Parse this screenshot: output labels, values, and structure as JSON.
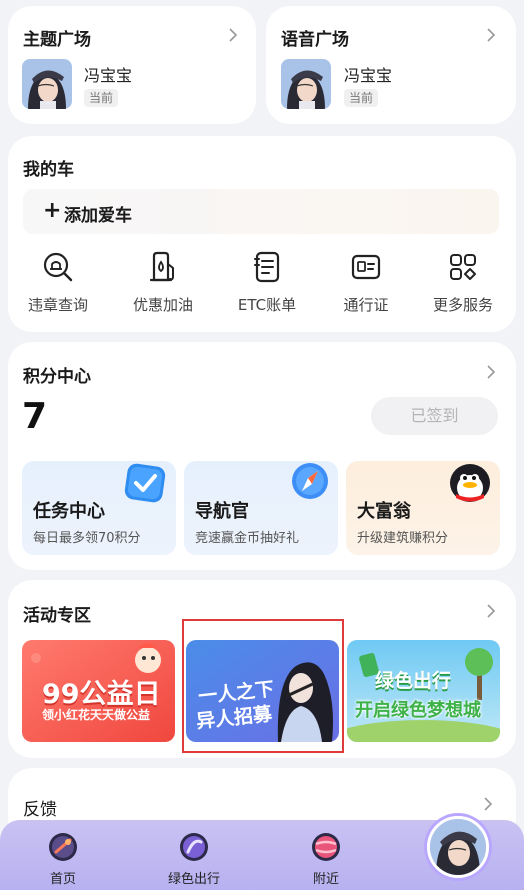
{
  "theme_card": {
    "title": "主题广场",
    "nickname": "冯宝宝",
    "badge": "当前"
  },
  "voice_card": {
    "title": "语音广场",
    "nickname": "冯宝宝",
    "badge": "当前"
  },
  "car": {
    "title": "我的车",
    "add_car_label": "添加爱车",
    "services": [
      {
        "label": "违章查询",
        "icon": "violation-search-icon"
      },
      {
        "label": "优惠加油",
        "icon": "fuel-icon"
      },
      {
        "label": "ETC账单",
        "icon": "etc-bill-icon"
      },
      {
        "label": "通行证",
        "icon": "pass-card-icon"
      },
      {
        "label": "更多服务",
        "icon": "more-grid-icon"
      }
    ]
  },
  "points": {
    "title": "积分中心",
    "value": "7",
    "signed_label": "已签到",
    "tasks": [
      {
        "title": "任务中心",
        "subtitle": "每日最多领70积分",
        "icon": "checkbox-icon"
      },
      {
        "title": "导航官",
        "subtitle": "竞速赢金币抽好礼",
        "icon": "compass-icon"
      },
      {
        "title": "大富翁",
        "subtitle": "升级建筑赚积分",
        "icon": "penguin-icon"
      }
    ]
  },
  "activities": {
    "title": "活动专区",
    "banners": [
      {
        "line1": "99公益日",
        "line2": "领小红花天天做公益"
      },
      {
        "line1": "一人之下",
        "line2": "异人招募"
      },
      {
        "line1": "绿色出行",
        "line2": "开启绿色梦想城"
      }
    ]
  },
  "feedback": {
    "title": "反馈"
  },
  "bottom_nav": {
    "items": [
      {
        "label": "首页"
      },
      {
        "label": "绿色出行"
      },
      {
        "label": "附近"
      }
    ]
  },
  "colors": {
    "background": "#f2f3f7",
    "nav_bar": "#bdb5f2",
    "highlight_border": "#e03b3b",
    "task_blue": "#e8f1fd",
    "task_orange": "#fdf0e3",
    "service_icon": "#222222"
  }
}
